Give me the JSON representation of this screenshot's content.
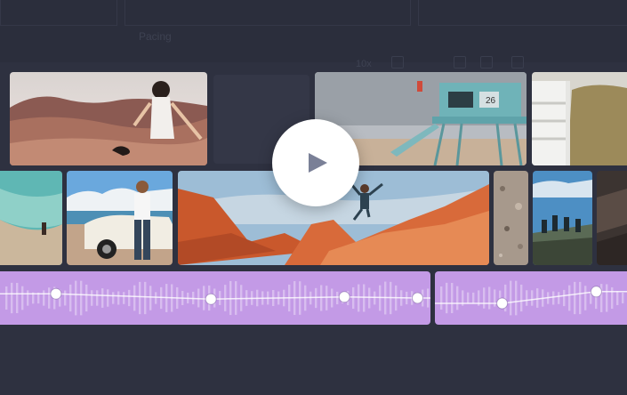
{
  "toolbar": {
    "label": "Pacing",
    "zoom": "10x"
  },
  "clips": {
    "desert_woman": "desert-woman-clip",
    "lifeguard_tower": "lifeguard-tower-clip",
    "white_stairs": "white-stairs-clip",
    "beach_walker": "beach-walker-clip",
    "man_with_car": "man-with-car-clip",
    "red_rock_jump": "red-rock-jump-clip",
    "gravel": "gravel-clip",
    "hikers": "hikers-clip",
    "dark_rock": "dark-rock-clip"
  },
  "audio": {
    "color": "#c39ae6",
    "clip1_keyframe_levels": [
      0.58,
      0.48,
      0.52,
      0.5
    ],
    "clip2_keyframe_levels": [
      0.4,
      0.62
    ]
  },
  "colors": {
    "background": "#2e3140",
    "play_button": "#ffffff",
    "play_icon": "#7a8097"
  }
}
